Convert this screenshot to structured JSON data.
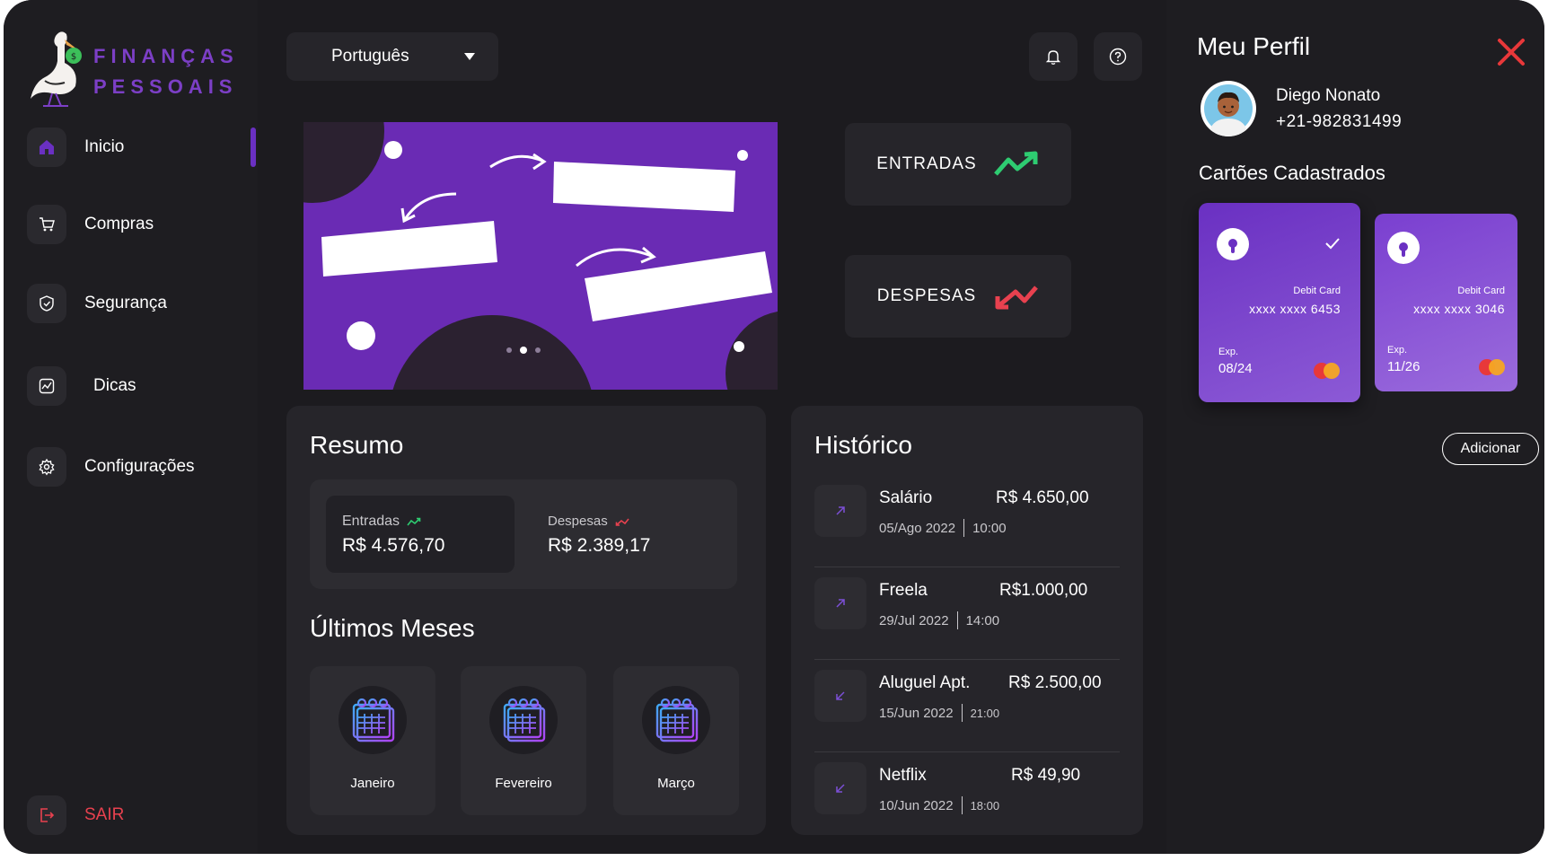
{
  "brand": {
    "line1": "FINANÇAS",
    "line2": "PESSOAIS"
  },
  "sidebar": {
    "items": [
      {
        "label": "Inicio",
        "icon": "home-icon"
      },
      {
        "label": "Compras",
        "icon": "cart-icon"
      },
      {
        "label": "Segurança",
        "icon": "shield-icon"
      },
      {
        "label": "Dicas",
        "icon": "chart-icon"
      },
      {
        "label": "Configurações",
        "icon": "gear-icon"
      }
    ],
    "logout_label": "SAIR"
  },
  "header": {
    "language": "Português"
  },
  "stats": {
    "income_label": "ENTRADAS",
    "expense_label": "DESPESAS"
  },
  "summary": {
    "title": "Resumo",
    "income_label": "Entradas",
    "income_value": "R$ 4.576,70",
    "expense_label": "Despesas",
    "expense_value": "R$ 2.389,17"
  },
  "months": {
    "title": "Últimos Meses",
    "items": [
      "Janeiro",
      "Fevereiro",
      "Março"
    ]
  },
  "history": {
    "title": "Histórico",
    "items": [
      {
        "name": "Salário",
        "amount": "R$ 4.650,00",
        "date": "05/Ago 2022",
        "time": "10:00",
        "direction": "in"
      },
      {
        "name": "Freela",
        "amount": "R$1.000,00",
        "date": "29/Jul 2022",
        "time": "14:00",
        "direction": "in"
      },
      {
        "name": "Aluguel Apt.",
        "amount": "R$ 2.500,00",
        "date": "15/Jun 2022",
        "time": "21:00",
        "direction": "out"
      },
      {
        "name": "Netflix",
        "amount": "R$ 49,90",
        "date": "10/Jun 2022",
        "time": "18:00",
        "direction": "out"
      }
    ]
  },
  "profile": {
    "title": "Meu Perfil",
    "name": "Diego Nonato",
    "phone": "+21-982831499",
    "cards_title": "Cartões Cadastrados",
    "cards": [
      {
        "type": "Debit Card",
        "number": "xxxx xxxx 6453",
        "exp_label": "Exp.",
        "exp": "08/24",
        "selected": true
      },
      {
        "type": "Debit Card",
        "number": "xxxx xxxx 3046",
        "exp_label": "Exp.",
        "exp": "11/26",
        "selected": false
      }
    ],
    "add_label": "Adicionar"
  },
  "colors": {
    "accent": "#6a30c2",
    "income": "#2ecc71",
    "expense": "#e8414f",
    "banner": "#6a2bb4"
  }
}
